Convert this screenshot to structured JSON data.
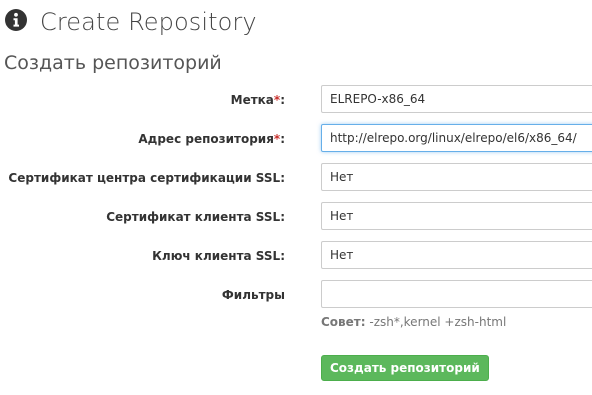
{
  "header": {
    "icon": "info-circle-icon",
    "title": "Create Repository"
  },
  "form": {
    "title": "Создать репозиторий",
    "required_mark": "*",
    "fields": [
      {
        "label": "Метка",
        "required": true,
        "value": "ELREPO-x86_64"
      },
      {
        "label": "Адрес репозитория",
        "required": true,
        "value": "http://elrepo.org/linux/elrepo/el6/x86_64/"
      },
      {
        "label": "Сертификат центра сертификации SSL:",
        "required": false,
        "value": "Нет"
      },
      {
        "label": "Сертификат клиента SSL:",
        "required": false,
        "value": "Нет"
      },
      {
        "label": "Ключ клиента SSL:",
        "required": false,
        "value": "Нет"
      },
      {
        "label": "Фильтры",
        "required": false,
        "value": ""
      }
    ],
    "hint_label": "Совет:",
    "hint_text": " -zsh*,kernel +zsh-html",
    "submit_label": "Создать репозиторий"
  },
  "colors": {
    "submit_bg": "#5cb85c",
    "required": "#c9302c",
    "focus": "#66afe9"
  }
}
